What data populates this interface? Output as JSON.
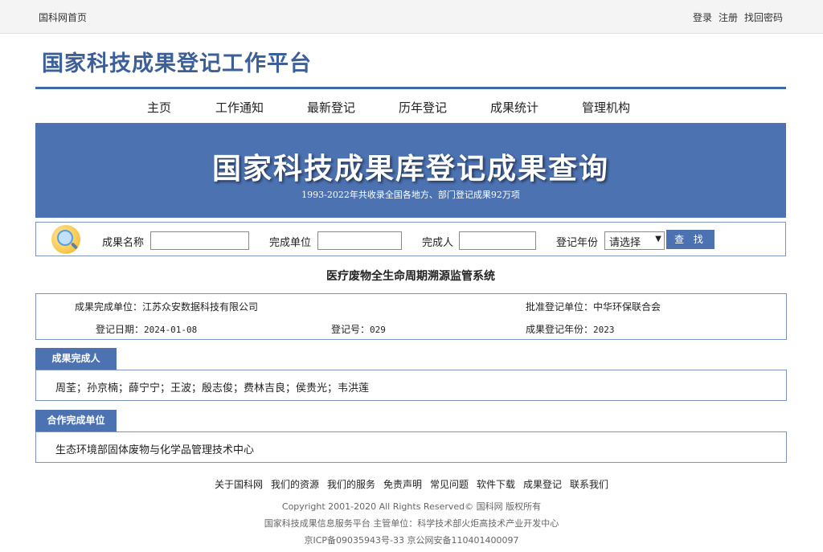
{
  "topbar": {
    "home": "国科网首页",
    "login": "登录",
    "register": "注册",
    "recover": "找回密码"
  },
  "site": {
    "logo_text": "国家科技成果登记工作平台"
  },
  "nav": {
    "items": [
      {
        "label": "主页"
      },
      {
        "label": "工作通知"
      },
      {
        "label": "最新登记"
      },
      {
        "label": "历年登记"
      },
      {
        "label": "成果统计"
      },
      {
        "label": "管理机构"
      }
    ]
  },
  "banner": {
    "title": "国家科技成果库登记成果查询",
    "subtitle": "1993-2022年共收录全国各地方、部门登记成果92万项"
  },
  "search": {
    "name_label": "成果名称",
    "name_value": "",
    "unit_label": "完成单位",
    "unit_value": "",
    "person_label": "完成人",
    "person_value": "",
    "year_label": "登记年份",
    "year_selected": "请选择",
    "button": "查 找",
    "icon": "magnifier-icon"
  },
  "result": {
    "title": "医疗废物全生命周期溯源监管系统",
    "unit_label": "成果完成单位：",
    "unit_value": "江苏众安数据科技有限公司",
    "approve_label": "批准登记单位：",
    "approve_value": "中华环保联合会",
    "date_label": "登记日期：",
    "date_value": "2024-01-08",
    "regno_label": "登记号：",
    "regno_value": "029",
    "year_label": "成果登记年份：",
    "year_value": "2023"
  },
  "sections": {
    "persons_title": "成果完成人",
    "persons_value": "周荃；孙京楠；薛宁宁；王波；殷志俊；费林吉良；侯贵光；韦洪莲",
    "coop_title": "合作完成单位",
    "coop_value": "生态环境部固体废物与化学品管理技术中心"
  },
  "footer": {
    "links": [
      {
        "label": "关于国科网"
      },
      {
        "label": "我们的资源"
      },
      {
        "label": "我们的服务"
      },
      {
        "label": "免责声明"
      },
      {
        "label": "常见问题"
      },
      {
        "label": "软件下载"
      },
      {
        "label": "成果登记"
      },
      {
        "label": "联系我们"
      }
    ],
    "copyright": "Copyright 2001-2020 All Rights Reserved© 国科网 版权所有",
    "organizer": "国家科技成果信息服务平台 主管单位：科学技术部火炬高技术产业开发中心",
    "icp": "京ICP备09035943号-33 京公网安备110401400097"
  },
  "colors": {
    "brand_blue": "#4c72b2",
    "border_blue": "#7c95bf",
    "logo_blue": "#3c5f97"
  }
}
